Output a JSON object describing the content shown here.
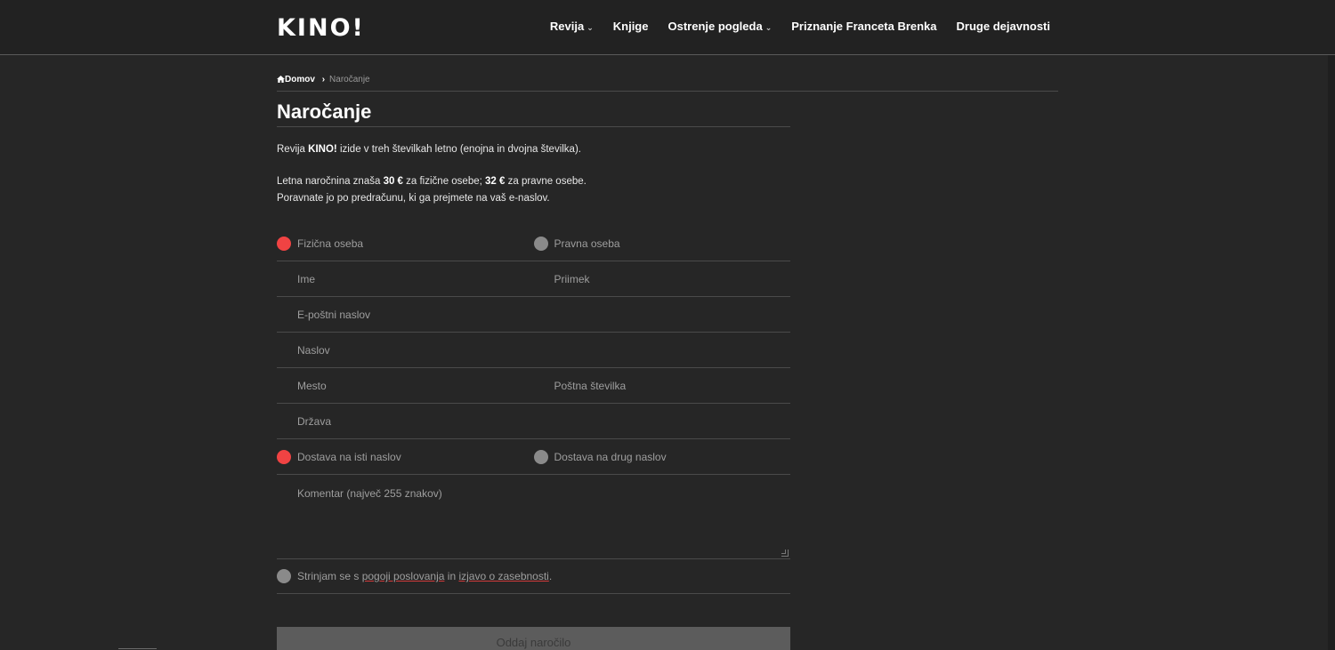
{
  "header": {
    "logo": "KINO!",
    "nav": [
      {
        "label": "Revija",
        "dropdown": true
      },
      {
        "label": "Knjige",
        "dropdown": false
      },
      {
        "label": "Ostrenje pogleda",
        "dropdown": true
      },
      {
        "label": "Priznanje Franceta Brenka",
        "dropdown": false
      },
      {
        "label": "Druge dejavnosti",
        "dropdown": false
      }
    ],
    "chevron": "⌄"
  },
  "breadcrumb": {
    "home_icon": "home-icon",
    "home": "Domov",
    "separator": "›",
    "current": "Naročanje"
  },
  "page": {
    "title": "Naročanje",
    "intro1_pre": "Revija ",
    "intro1_bold": "KINO!",
    "intro1_post": " izide v treh številkah letno (enojna in dvojna številka).",
    "intro2_pre": "Letna naročnina znaša ",
    "intro2_price1": "30 €",
    "intro2_mid": " za fizične osebe; ",
    "intro2_price2": "32 €",
    "intro2_post": " za pravne osebe.",
    "intro3": "Poravnate jo po predračunu, ki ga prejmete na vaš e-naslov."
  },
  "form": {
    "person_type": {
      "option1": "Fizična oseba",
      "option2": "Pravna oseba",
      "selected": "Fizična oseba"
    },
    "first_name_placeholder": "Ime",
    "last_name_placeholder": "Priimek",
    "email_placeholder": "E-poštni naslov",
    "address_placeholder": "Naslov",
    "city_placeholder": "Mesto",
    "postal_placeholder": "Poštna številka",
    "country_placeholder": "Država",
    "delivery": {
      "option1": "Dostava na isti naslov",
      "option2": "Dostava na drug naslov",
      "selected": "Dostava na isti naslov"
    },
    "comment_placeholder": "Komentar (največ 255 znakov)",
    "consent_pre": "Strinjam se s ",
    "consent_link1": "pogoji poslovanja",
    "consent_mid": " in ",
    "consent_link2": "izjavo o zasebnosti",
    "consent_post": ".",
    "submit": "Oddaj naročilo"
  },
  "colors": {
    "background": "#262626",
    "header": "#222222",
    "accent_radio": "#f04343",
    "radio_off": "#8a8a8a",
    "submit_bg": "#5c5c5c"
  }
}
